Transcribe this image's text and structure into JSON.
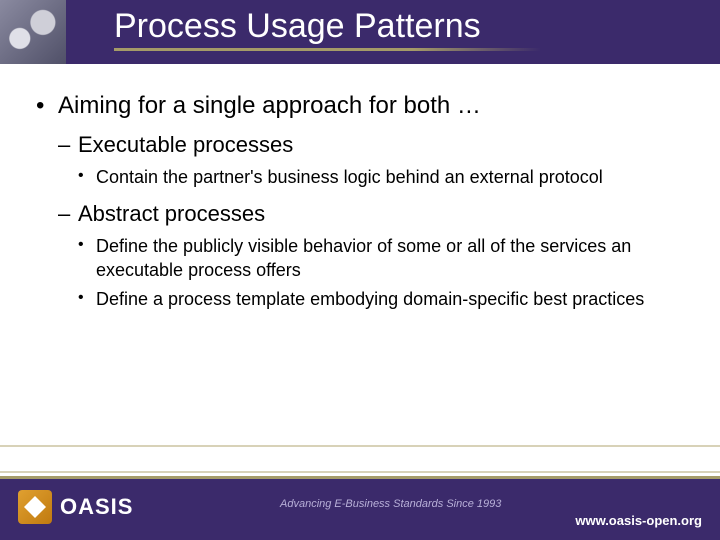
{
  "title": "Process Usage Patterns",
  "bullets": {
    "l1_1": "Aiming for a single approach for both …",
    "l2_1": "Executable processes",
    "l3_1": "Contain the partner's business logic behind an external protocol",
    "l2_2": "Abstract processes",
    "l3_2": "Define the publicly visible behavior of some or all of the services an executable process offers",
    "l3_3": "Define a process template embodying domain-specific best practices"
  },
  "footer": {
    "logo_text": "OASIS",
    "tagline": "Advancing E-Business Standards Since 1993",
    "url": "www.oasis-open.org"
  }
}
